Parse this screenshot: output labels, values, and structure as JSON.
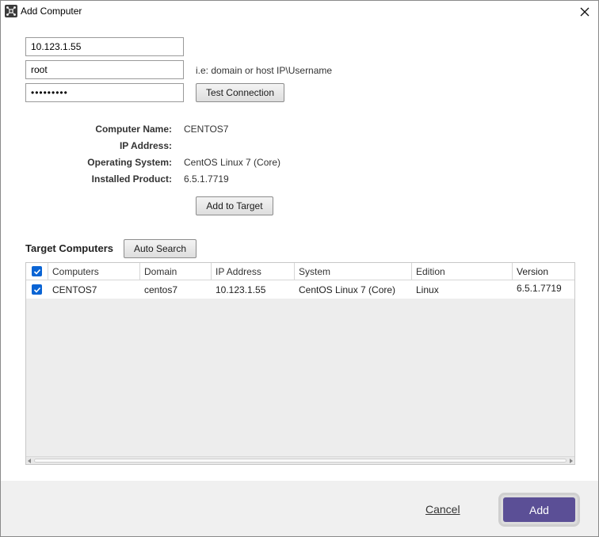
{
  "window": {
    "title": "Add Computer"
  },
  "connection": {
    "host_value": "10.123.1.55",
    "username_value": "root",
    "username_hint": "i.e: domain or host IP\\Username",
    "password_value": "•••••••••",
    "test_button": "Test Connection"
  },
  "info": {
    "computer_name_label": "Computer Name:",
    "computer_name_value": "CENTOS7",
    "ip_label": "IP Address:",
    "ip_value": "",
    "os_label": "Operating System:",
    "os_value": "CentOS Linux 7 (Core)",
    "product_label": "Installed Product:",
    "product_value": "6.5.1.7719",
    "add_target_button": "Add to Target"
  },
  "targets": {
    "title": "Target Computers",
    "auto_search_button": "Auto Search",
    "columns": [
      "Computers",
      "Domain",
      "IP Address",
      "System",
      "Edition",
      "Version"
    ],
    "rows": [
      {
        "computer": "CENTOS7",
        "domain": "centos7",
        "ip": "10.123.1.55",
        "system": "CentOS Linux 7 (Core)",
        "edition": "Linux",
        "version": "6.5.1.7719"
      }
    ]
  },
  "footer": {
    "cancel": "Cancel",
    "add": "Add"
  },
  "colors": {
    "accent": "#5b4f96",
    "checkbox": "#0a64d4",
    "footer_bg": "#f0f0f0"
  }
}
